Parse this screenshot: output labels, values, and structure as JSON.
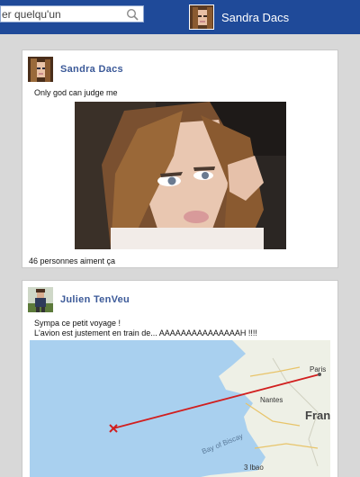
{
  "header": {
    "search_placeholder": "er quelqu'un",
    "user_name": "Sandra Dacs",
    "brand_color": "#1f4a99"
  },
  "icons": {
    "search": "search-icon"
  },
  "posts": [
    {
      "author": "Sandra Dacs",
      "text": "Only god can judge me",
      "likes": "46 personnes aiment ça"
    },
    {
      "author": "Julien TenVeu",
      "text_line1": "Sympa ce petit voyage !",
      "text_line2": "L'avion est justement en train de... AAAAAAAAAAAAAAAH !!!!",
      "map_labels": {
        "paris": "Paris",
        "nantes": "Nantes",
        "france": "Franc",
        "bay": "Bay of Biscay",
        "bilbao": "3 lbao"
      }
    }
  ]
}
